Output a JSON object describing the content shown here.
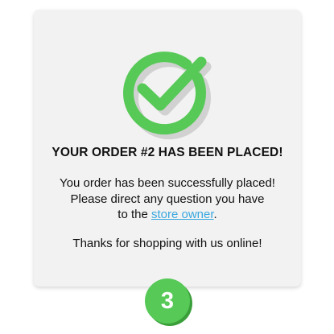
{
  "order_card": {
    "title": "YOUR ORDER #2 HAS BEEN PLACED!",
    "message_line1": "You order has been successfully placed!",
    "message_line2": "Please direct any question you have",
    "message_line3_prefix": "to the ",
    "store_owner_link": "store owner",
    "message_line3_suffix": ".",
    "thanks": "Thanks for shopping with us online!"
  },
  "step_badge": {
    "number": "3"
  },
  "colors": {
    "card_background": "#f2f2f2",
    "check_green": "#57c957",
    "link_blue": "#3aa8df",
    "badge_green": "#57c957",
    "badge_shadow": "#3a9e3a"
  },
  "icons": {
    "success": "check-circle-icon"
  }
}
